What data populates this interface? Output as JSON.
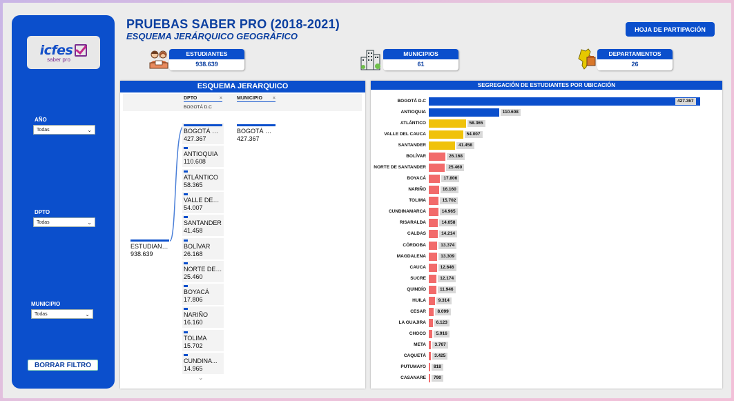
{
  "header": {
    "title": "PRUEBAS SABER PRO (2018-2021)",
    "subtitle": "ESQUEMA JERÁRQUICO GEOGRÁFICO",
    "hoja_button": "HOJA DE PARTIPACIÓN"
  },
  "sidebar": {
    "logo_text": "icfes",
    "logo_sub": "saber pro",
    "filters": [
      {
        "label": "AÑO",
        "value": "Todas"
      },
      {
        "label": "DPTO",
        "value": "Todas"
      },
      {
        "label": "MUNICIPIO",
        "value": "Todas"
      }
    ],
    "clear_button": "BORRAR FILTRO"
  },
  "kpis": {
    "estudiantes": {
      "label": "ESTUDIANTES",
      "value": "938.639",
      "icon": "students-icon"
    },
    "municipios": {
      "label": "MUNICIPIOS",
      "value": "61",
      "icon": "buildings-icon"
    },
    "departamentos": {
      "label": "DEPARTAMENTOS",
      "value": "26",
      "icon": "map-icon"
    }
  },
  "tree": {
    "title": "ESQUEMA JERARQUICO",
    "col1_label": "DPTO",
    "col1_filter": "BOGOTÁ D.C",
    "col2_label": "MUNICIPIO",
    "root": {
      "name": "ESTUDIANT...",
      "value": "938.639"
    },
    "dpto_nodes": [
      {
        "name": "BOGOTÁ D.C",
        "value": "427.367"
      },
      {
        "name": "ANTIOQUIA",
        "value": "110.608"
      },
      {
        "name": "ATLÁNTICO",
        "value": "58.365"
      },
      {
        "name": "VALLE DEL ...",
        "value": "54.007"
      },
      {
        "name": "SANTANDER",
        "value": "41.458"
      },
      {
        "name": "BOLÍVAR",
        "value": "26.168"
      },
      {
        "name": "NORTE DE ...",
        "value": "25.460"
      },
      {
        "name": "BOYACÁ",
        "value": "17.806"
      },
      {
        "name": "NARIÑO",
        "value": "16.160"
      },
      {
        "name": "TOLIMA",
        "value": "15.702"
      },
      {
        "name": "CUNDINA...",
        "value": "14.965"
      }
    ],
    "municipio_nodes": [
      {
        "name": "BOGOTÁ D.C",
        "value": "427.367"
      }
    ]
  },
  "chart_data": {
    "type": "bar",
    "title": "SEGREGACIÓN DE ESTUDIANTES  POR UBICACIÓN",
    "orientation": "horizontal",
    "categories": [
      "BOGOTÁ D.C",
      "ANTIOQUIA",
      "ATLÁNTICO",
      "VALLE DEL CAUCA",
      "SANTANDER",
      "BOLÍVAR",
      "NORTE DE SANTANDER",
      "BOYACÁ",
      "NARIÑO",
      "TOLIMA",
      "CUNDINAMARCA",
      "RISARALDA",
      "CALDAS",
      "CÓRDOBA",
      "MAGDALENA",
      "CAUCA",
      "SUCRE",
      "QUINDÍO",
      "HUILA",
      "CESAR",
      "LA GUAJIRA",
      "CHOCO",
      "META",
      "CAQUETÁ",
      "PUTUMAYO",
      "CASANARE"
    ],
    "values": [
      427367,
      110608,
      58365,
      54007,
      41458,
      26168,
      25460,
      17806,
      16160,
      15702,
      14965,
      14658,
      14214,
      13374,
      13309,
      12646,
      12174,
      11946,
      9314,
      8099,
      6123,
      5916,
      3767,
      3425,
      818,
      790
    ],
    "value_labels": [
      "427.367",
      "110.608",
      "58.365",
      "54.007",
      "41.458",
      "26.168",
      "25.460",
      "17.806",
      "16.160",
      "15.702",
      "14.965",
      "14.658",
      "14.214",
      "13.374",
      "13.309",
      "12.646",
      "12.174",
      "11.946",
      "9.314",
      "8.099",
      "6.123",
      "5.916",
      "3.767",
      "3.425",
      "818",
      "790"
    ],
    "colors": {
      "high": "#0b4fcc",
      "mid": "#f0c20a",
      "low": "#f26b6b"
    },
    "color_groups": [
      "high",
      "high",
      "mid",
      "mid",
      "mid",
      "low",
      "low",
      "low",
      "low",
      "low",
      "low",
      "low",
      "low",
      "low",
      "low",
      "low",
      "low",
      "low",
      "low",
      "low",
      "low",
      "low",
      "low",
      "low",
      "low",
      "low"
    ]
  }
}
